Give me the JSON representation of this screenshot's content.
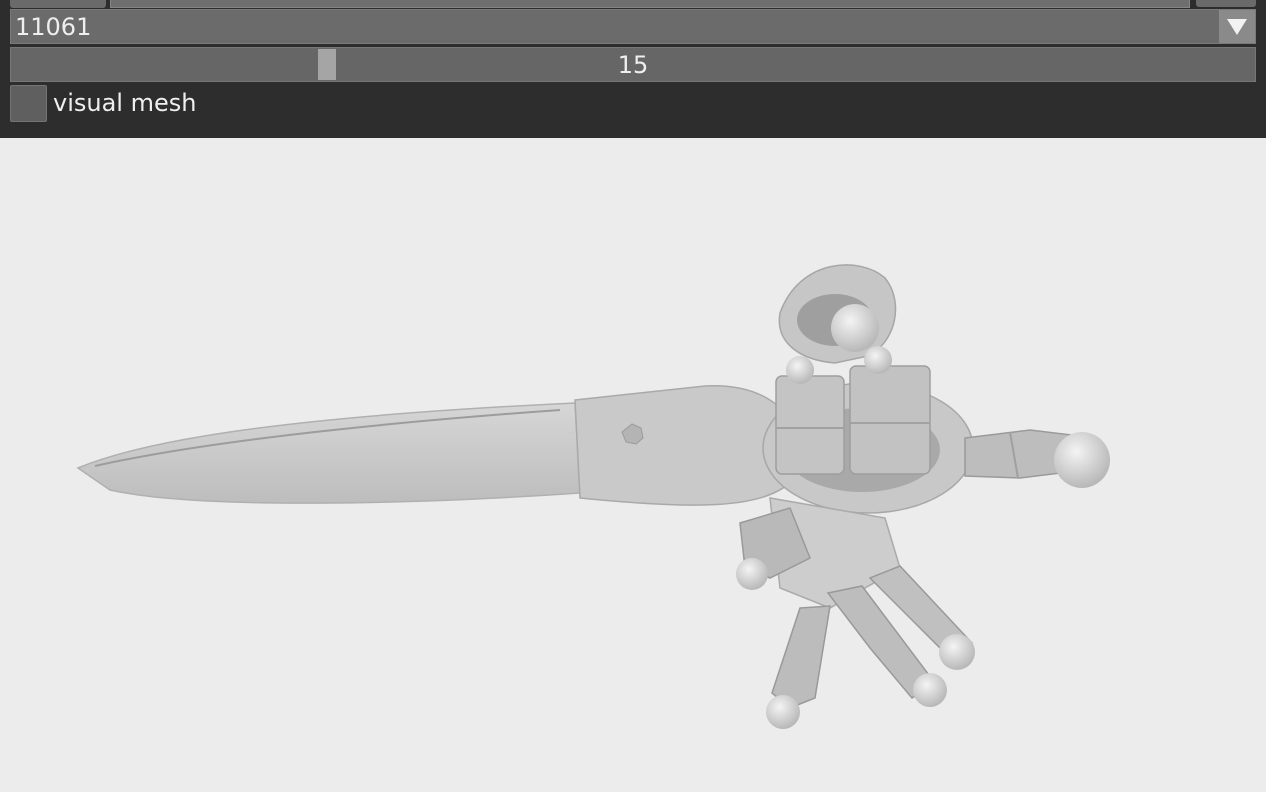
{
  "controls": {
    "object_select": {
      "value": "11061"
    },
    "frame_slider": {
      "value": 15,
      "min": 0,
      "max": 60,
      "fraction": 0.25
    },
    "visual_mesh": {
      "label": "visual mesh",
      "checked": false
    }
  },
  "icons": {
    "dropdown": "chevron-down-icon"
  },
  "colors": {
    "panel_bg": "#2d2d2d",
    "widget_bg": "#6b6b6b",
    "viewport_bg": "#ececec",
    "mesh_fill": "#c8c8c8"
  }
}
